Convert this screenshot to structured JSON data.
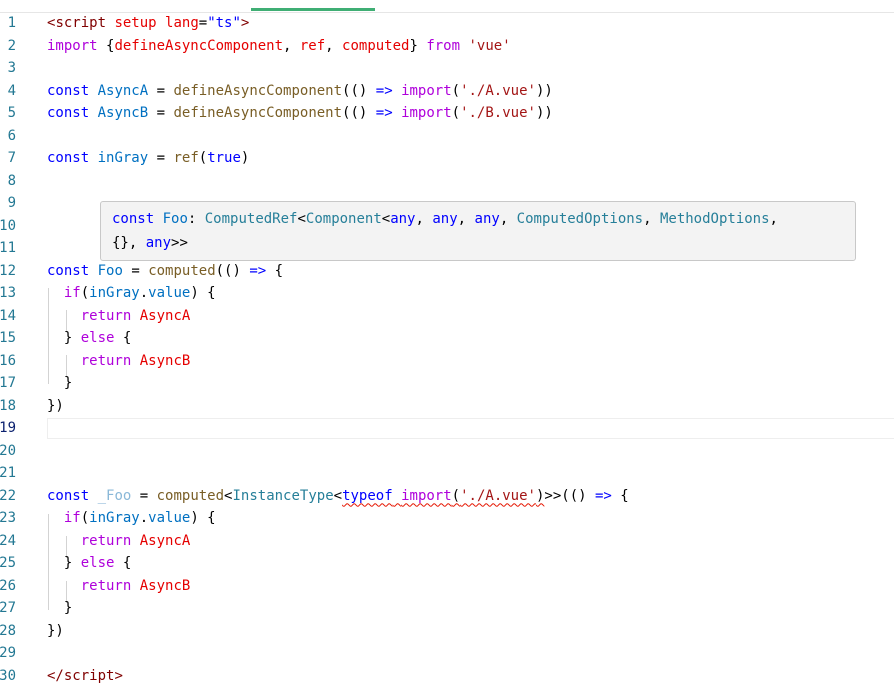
{
  "lines": [
    {
      "n": "1",
      "tokens": [
        [
          "br",
          "<"
        ],
        [
          "tag",
          "script"
        ],
        [
          "p",
          " "
        ],
        [
          "attr",
          "setup"
        ],
        [
          "p",
          " "
        ],
        [
          "attr",
          "lang"
        ],
        [
          "p",
          "="
        ],
        [
          "kw",
          "\"ts\""
        ],
        [
          "br",
          ">"
        ]
      ]
    },
    {
      "n": "2",
      "tokens": [
        [
          "ctl",
          "import"
        ],
        [
          "p",
          " {"
        ],
        [
          "attr",
          "defineAsyncComponent"
        ],
        [
          "p",
          ", "
        ],
        [
          "attr",
          "ref"
        ],
        [
          "p",
          ", "
        ],
        [
          "attr",
          "computed"
        ],
        [
          "p",
          "} "
        ],
        [
          "ctl",
          "from"
        ],
        [
          "p",
          " "
        ],
        [
          "str",
          "'vue'"
        ]
      ]
    },
    {
      "n": "3",
      "tokens": []
    },
    {
      "n": "4",
      "tokens": [
        [
          "kw",
          "const"
        ],
        [
          "p",
          " "
        ],
        [
          "var",
          "AsyncA"
        ],
        [
          "p",
          " = "
        ],
        [
          "fn",
          "defineAsyncComponent"
        ],
        [
          "p",
          "(() "
        ],
        [
          "kw",
          "=>"
        ],
        [
          "p",
          " "
        ],
        [
          "ctl",
          "import"
        ],
        [
          "p",
          "("
        ],
        [
          "str",
          "'./A.vue'"
        ],
        [
          "p",
          "))"
        ]
      ]
    },
    {
      "n": "5",
      "tokens": [
        [
          "kw",
          "const"
        ],
        [
          "p",
          " "
        ],
        [
          "var",
          "AsyncB"
        ],
        [
          "p",
          " = "
        ],
        [
          "fn",
          "defineAsyncComponent"
        ],
        [
          "p",
          "(() "
        ],
        [
          "kw",
          "=>"
        ],
        [
          "p",
          " "
        ],
        [
          "ctl",
          "import"
        ],
        [
          "p",
          "("
        ],
        [
          "str",
          "'./B.vue'"
        ],
        [
          "p",
          "))"
        ]
      ]
    },
    {
      "n": "6",
      "tokens": []
    },
    {
      "n": "7",
      "tokens": [
        [
          "kw",
          "const"
        ],
        [
          "p",
          " "
        ],
        [
          "var",
          "inGray"
        ],
        [
          "p",
          " = "
        ],
        [
          "fn",
          "ref"
        ],
        [
          "p",
          "("
        ],
        [
          "kw",
          "true"
        ],
        [
          "p",
          ")"
        ]
      ]
    },
    {
      "n": "8",
      "tokens": []
    },
    {
      "n": "9",
      "tokens": []
    },
    {
      "n": "10",
      "tokens": []
    },
    {
      "n": "11",
      "tokens": []
    },
    {
      "n": "12",
      "tokens": [
        [
          "kw",
          "const"
        ],
        [
          "p",
          " "
        ],
        [
          "var",
          "Foo"
        ],
        [
          "p",
          " = "
        ],
        [
          "fn",
          "computed"
        ],
        [
          "p",
          "(() "
        ],
        [
          "kw",
          "=>"
        ],
        [
          "p",
          " {"
        ]
      ]
    },
    {
      "n": "13",
      "tokens": [
        [
          "p",
          "  "
        ],
        [
          "ctl",
          "if"
        ],
        [
          "p",
          "("
        ],
        [
          "var",
          "inGray"
        ],
        [
          "p",
          "."
        ],
        [
          "var",
          "value"
        ],
        [
          "p",
          ") {"
        ]
      ]
    },
    {
      "n": "14",
      "tokens": [
        [
          "p",
          "    "
        ],
        [
          "ctl",
          "return"
        ],
        [
          "p",
          " "
        ],
        [
          "attr",
          "AsyncA"
        ]
      ]
    },
    {
      "n": "15",
      "tokens": [
        [
          "p",
          "  } "
        ],
        [
          "ctl",
          "else"
        ],
        [
          "p",
          " {"
        ]
      ]
    },
    {
      "n": "16",
      "tokens": [
        [
          "p",
          "    "
        ],
        [
          "ctl",
          "return"
        ],
        [
          "p",
          " "
        ],
        [
          "attr",
          "AsyncB"
        ]
      ]
    },
    {
      "n": "17",
      "tokens": [
        [
          "p",
          "  }"
        ]
      ]
    },
    {
      "n": "18",
      "tokens": [
        [
          "p",
          "})"
        ]
      ]
    },
    {
      "n": "19",
      "tokens": []
    },
    {
      "n": "20",
      "tokens": []
    },
    {
      "n": "21",
      "tokens": []
    },
    {
      "n": "22",
      "tokens": [
        [
          "kw",
          "const"
        ],
        [
          "p",
          " "
        ],
        [
          "vdim",
          "_Foo"
        ],
        [
          "p",
          " = "
        ],
        [
          "fn",
          "computed"
        ],
        [
          "p",
          "<"
        ],
        [
          "type",
          "InstanceType"
        ],
        [
          "p",
          "<"
        ],
        [
          "squig:typeof",
          "typeof"
        ],
        [
          "squig:p",
          " "
        ],
        [
          "squig:ctl",
          "import"
        ],
        [
          "squig:p",
          "("
        ],
        [
          "squig:str",
          "'./A.vue'"
        ],
        [
          "squig:p",
          ")"
        ],
        [
          "p",
          ">>(() "
        ],
        [
          "kw",
          "=>"
        ],
        [
          "p",
          " {"
        ]
      ]
    },
    {
      "n": "23",
      "tokens": [
        [
          "p",
          "  "
        ],
        [
          "ctl",
          "if"
        ],
        [
          "p",
          "("
        ],
        [
          "var",
          "inGray"
        ],
        [
          "p",
          "."
        ],
        [
          "var",
          "value"
        ],
        [
          "p",
          ") {"
        ]
      ]
    },
    {
      "n": "24",
      "tokens": [
        [
          "p",
          "    "
        ],
        [
          "ctl",
          "return"
        ],
        [
          "p",
          " "
        ],
        [
          "attr",
          "AsyncA"
        ]
      ]
    },
    {
      "n": "25",
      "tokens": [
        [
          "p",
          "  } "
        ],
        [
          "ctl",
          "else"
        ],
        [
          "p",
          " {"
        ]
      ]
    },
    {
      "n": "26",
      "tokens": [
        [
          "p",
          "    "
        ],
        [
          "ctl",
          "return"
        ],
        [
          "p",
          " "
        ],
        [
          "attr",
          "AsyncB"
        ]
      ]
    },
    {
      "n": "27",
      "tokens": [
        [
          "p",
          "  }"
        ]
      ]
    },
    {
      "n": "28",
      "tokens": [
        [
          "p",
          "})"
        ]
      ]
    },
    {
      "n": "29",
      "tokens": []
    },
    {
      "n": "30",
      "tokens": [
        [
          "br",
          "</"
        ],
        [
          "tag",
          "script"
        ],
        [
          "br",
          ">"
        ]
      ]
    }
  ],
  "current_line": "19",
  "hover": {
    "tokens": [
      [
        "kw",
        "const"
      ],
      [
        "p",
        " "
      ],
      [
        "var",
        "Foo"
      ],
      [
        "p",
        ": "
      ],
      [
        "type",
        "ComputedRef"
      ],
      [
        "p",
        "<"
      ],
      [
        "type",
        "Component"
      ],
      [
        "p",
        "<"
      ],
      [
        "kw",
        "any"
      ],
      [
        "p",
        ", "
      ],
      [
        "kw",
        "any"
      ],
      [
        "p",
        ", "
      ],
      [
        "kw",
        "any"
      ],
      [
        "p",
        ", "
      ],
      [
        "type",
        "ComputedOptions"
      ],
      [
        "p",
        ", "
      ],
      [
        "type",
        "MethodOptions"
      ],
      [
        "p",
        ",\n{}, "
      ],
      [
        "kw",
        "any"
      ],
      [
        "p",
        ">>"
      ]
    ]
  }
}
